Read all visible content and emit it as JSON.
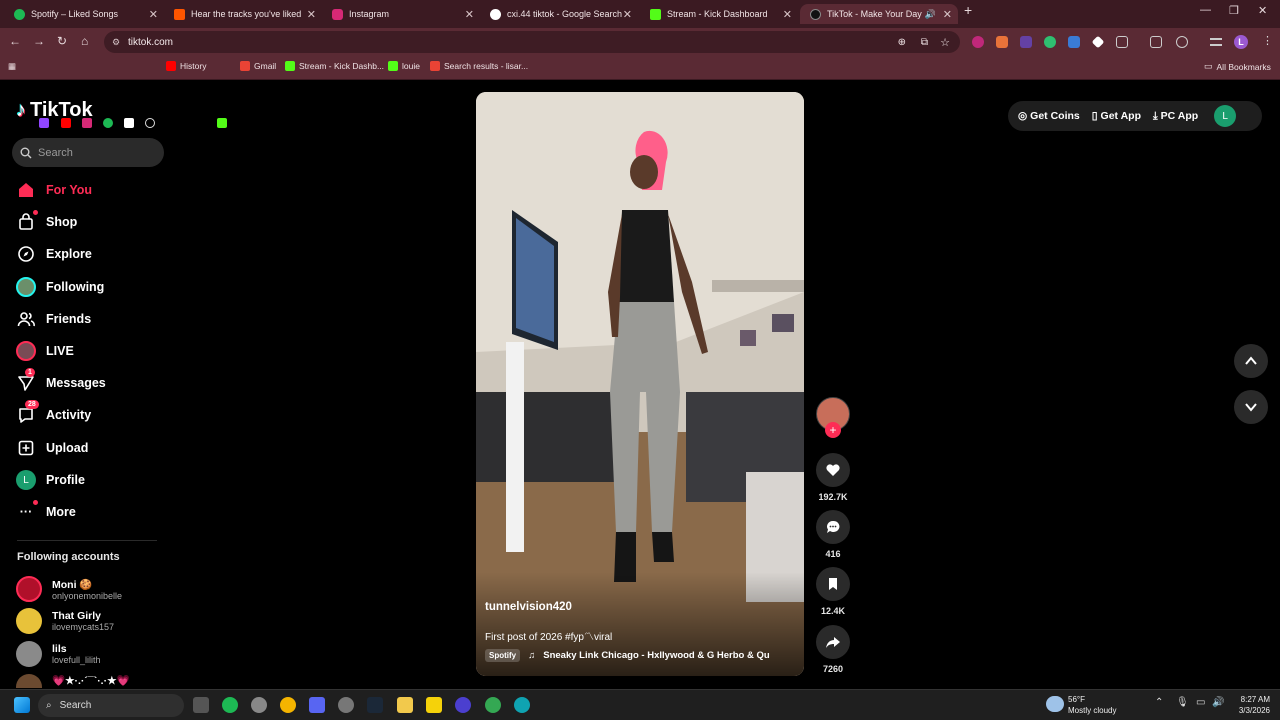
{
  "browser": {
    "tabs": [
      {
        "title": "Spotify – Liked Songs",
        "color": "#1db954"
      },
      {
        "title": "Hear the tracks you've liked: on",
        "color": "#ff5500"
      },
      {
        "title": "Instagram",
        "color": "#d62976"
      },
      {
        "title": "cxi.44 tiktok - Google Search",
        "color": "#ffffff"
      },
      {
        "title": "Stream - Kick Dashboard",
        "color": "#53fc18"
      },
      {
        "title": "TikTok - Make Your Day",
        "color": "#000000"
      }
    ],
    "url": "tiktok.com",
    "bookmarks": [
      "History",
      "Gmail",
      "Stream - Kick Dashb...",
      "louie",
      "Search results - lisar..."
    ],
    "all_bookmarks": "All Bookmarks",
    "profile_initial": "L"
  },
  "tiktok": {
    "logo": "TikTok",
    "search_placeholder": "Search",
    "nav": [
      {
        "label": "For You",
        "icon": "home-icon"
      },
      {
        "label": "Shop",
        "icon": "shop-icon"
      },
      {
        "label": "Explore",
        "icon": "compass-icon"
      },
      {
        "label": "Following",
        "icon": "following-avatar-icon"
      },
      {
        "label": "Friends",
        "icon": "friends-icon"
      },
      {
        "label": "LIVE",
        "icon": "live-avatar-icon"
      },
      {
        "label": "Messages",
        "icon": "messages-icon",
        "badge": "1"
      },
      {
        "label": "Activity",
        "icon": "activity-icon",
        "badge": "28"
      },
      {
        "label": "Upload",
        "icon": "upload-icon"
      },
      {
        "label": "Profile",
        "icon": "profile-icon",
        "initial": "L"
      },
      {
        "label": "More",
        "icon": "more-icon"
      }
    ],
    "following_accounts_title": "Following accounts",
    "following_accounts": [
      {
        "name": "Moni 🍪",
        "user": "onlyonemonibelle"
      },
      {
        "name": "That Girly",
        "user": "ilovemycats157"
      },
      {
        "name": "lils",
        "user": "lovefull_lilith"
      },
      {
        "name": "💗★·.·´¯`·.·★💗",
        "user": ""
      }
    ],
    "header": {
      "get_coins": "Get Coins",
      "get_app": "Get App",
      "pc_app": "PC App",
      "avatar_initial": "L"
    },
    "video": {
      "author": "tunnelvision420",
      "caption": "First post of 2026 #fyp〽viral",
      "music_source": "Spotify",
      "music": "Sneaky Link Chicago - Hxllywood & G Herbo & Qu"
    },
    "actions": {
      "likes": "192.7K",
      "comments": "416",
      "saves": "12.4K",
      "shares": "7260"
    }
  },
  "taskbar": {
    "search": "Search",
    "weather_temp": "56°F",
    "weather_desc": "Mostly cloudy",
    "time": "8:27 AM",
    "date": "3/3/2026"
  }
}
